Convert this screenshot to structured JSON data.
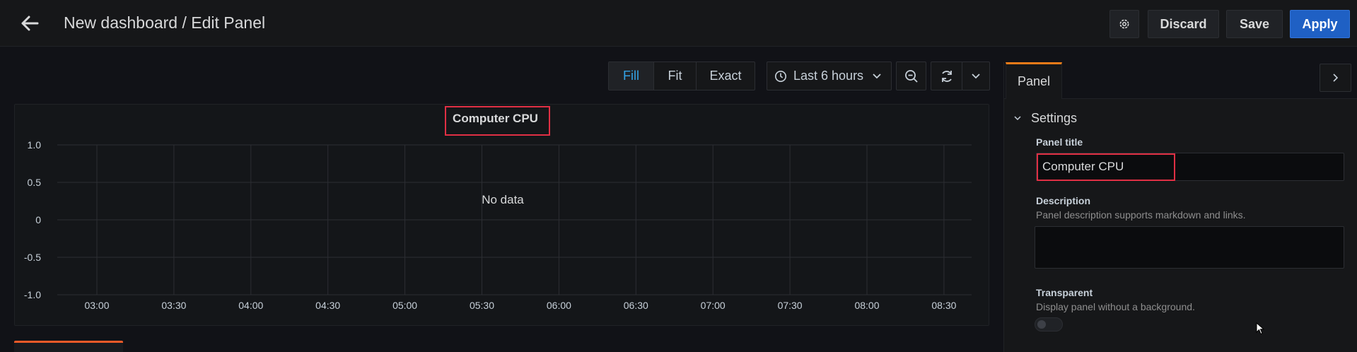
{
  "header": {
    "title": "New dashboard / Edit Panel",
    "icons": {
      "back": "arrow-left-icon",
      "settings": "gear-icon"
    },
    "discard_label": "Discard",
    "save_label": "Save",
    "apply_label": "Apply"
  },
  "toolbar": {
    "modes": [
      "Fill",
      "Fit",
      "Exact"
    ],
    "active_mode": "Fill",
    "time_range": "Last 6 hours",
    "icons": {
      "clock": "clock-icon",
      "zoom_out": "zoom-out-icon",
      "refresh": "refresh-icon",
      "chevron": "chevron-down-icon"
    }
  },
  "chart_data": {
    "type": "line",
    "title": "Computer CPU",
    "no_data_text": "No data",
    "x_ticks": [
      "03:00",
      "03:30",
      "04:00",
      "04:30",
      "05:00",
      "05:30",
      "06:00",
      "06:30",
      "07:00",
      "07:30",
      "08:00",
      "08:30"
    ],
    "y_ticks": [
      "1.0",
      "0.5",
      "0",
      "-0.5",
      "-1.0"
    ],
    "ylim": [
      -1.0,
      1.0
    ],
    "series": [],
    "grid": true
  },
  "options_pane": {
    "tab_label": "Panel",
    "section_label": "Settings",
    "panel_title_label": "Panel title",
    "panel_title_value": "Computer CPU",
    "description_label": "Description",
    "description_help": "Panel description supports markdown and links.",
    "description_value": "",
    "transparent_label": "Transparent",
    "transparent_help": "Display panel without a background.",
    "transparent_on": false
  },
  "colors": {
    "accent_blue": "#1f60c4",
    "active_mode_text": "#33a2e5",
    "tab_underline": "#eb7b18",
    "highlight": "#e02f44"
  }
}
